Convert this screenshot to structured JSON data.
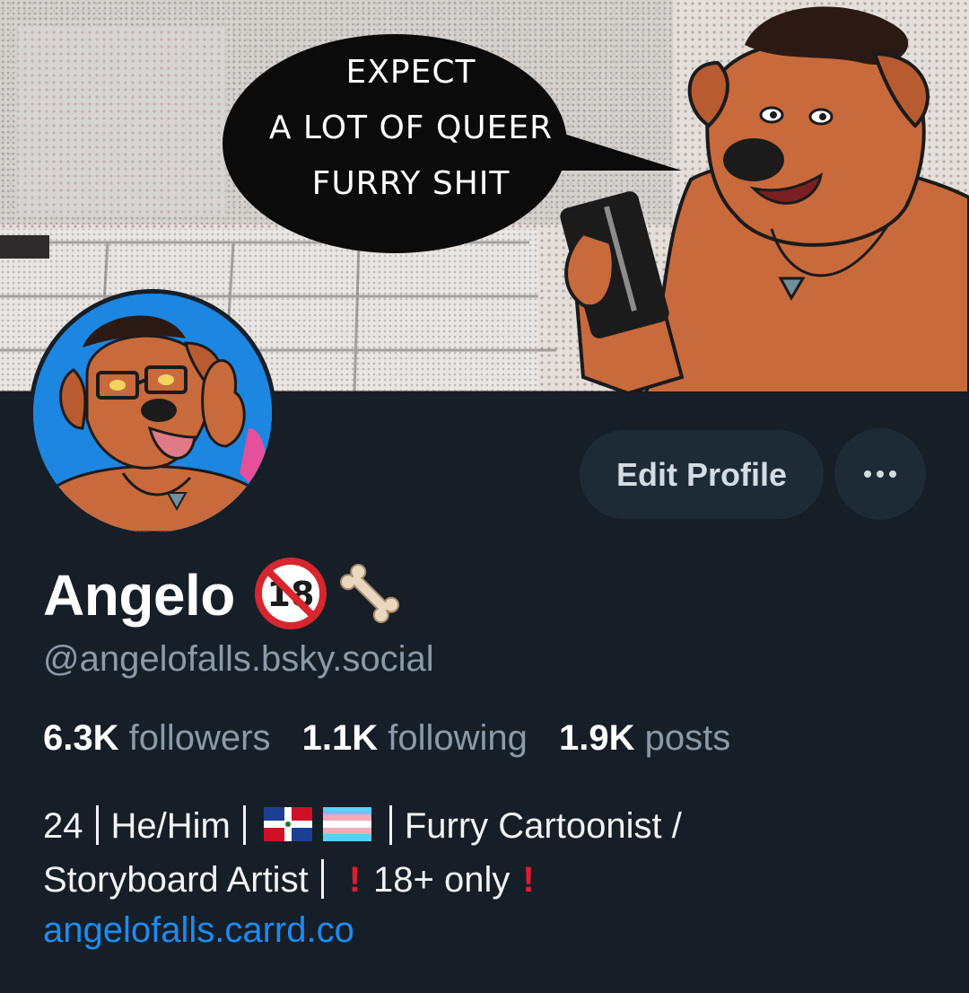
{
  "banner": {
    "speech_bubble": {
      "line1": "EXPECT",
      "line2": "A LOT OF QUEER",
      "line3": "FURRY SHIT"
    }
  },
  "profile": {
    "display_name": "Angelo",
    "name_emojis": [
      "no-under-18-icon",
      "bone-icon"
    ],
    "handle": "@angelofalls.bsky.social",
    "edit_label": "Edit Profile",
    "more_label": "•••"
  },
  "stats": {
    "followers_count": "6.3K",
    "followers_label": "followers",
    "following_count": "1.1K",
    "following_label": "following",
    "posts_count": "1.9K",
    "posts_label": "posts"
  },
  "bio": {
    "age": "24",
    "pronouns": "He/Him",
    "flags": [
      "dominican-republic-flag-icon",
      "transgender-flag-icon"
    ],
    "role_1": "Furry Cartoonist /",
    "role_2": "Storyboard Artist",
    "age_notice": "18+ only",
    "link": "angelofalls.carrd.co"
  },
  "colors": {
    "background": "#161e27",
    "button_bg": "#1e2a36",
    "muted_text": "#8c9aa8",
    "link": "#1d8cf0",
    "alert_red": "#e21b2e"
  }
}
